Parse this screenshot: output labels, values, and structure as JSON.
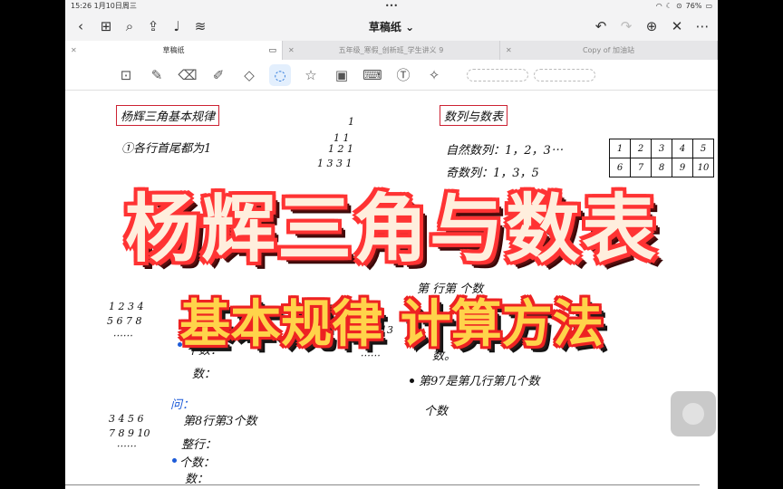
{
  "status": {
    "time": "15:26",
    "date": "1月10日周三",
    "dots": "•••",
    "battery": "76%"
  },
  "toolbar": {
    "title": "草稿纸",
    "title_caret": "⌄",
    "icons": [
      "back-icon",
      "grid-icon",
      "search-icon",
      "share-icon",
      "mic-icon",
      "audio-wave-icon",
      "undo-icon",
      "redo-icon",
      "add-page-icon",
      "close-icon",
      "more-icon"
    ]
  },
  "tabs": [
    {
      "label": "草稿纸",
      "active": true
    },
    {
      "label": "五年级_寒假_创新班_学生讲义 9",
      "active": false
    },
    {
      "label": "Copy of 加油站",
      "active": false
    }
  ],
  "tools": [
    "lasso-image-icon",
    "pen-icon",
    "eraser-icon",
    "highlighter-icon",
    "shapes-icon",
    "lasso-icon",
    "sticker-icon",
    "image-icon",
    "keyboard-icon",
    "text-icon",
    "laser-icon"
  ],
  "note": {
    "left_heading": "杨辉三角基本规律",
    "left_rule1": "①各行首尾都为1",
    "triangle": [
      "1",
      "1  1",
      "1  2  1",
      "1  3  3  1"
    ],
    "right_heading": "数列与数表",
    "nat_seq": "自然数列：1，2，3⋯",
    "odd_seq": "奇数列：1，3，5",
    "grid": [
      [
        "1",
        "2",
        "3",
        "4",
        "5"
      ],
      [
        "6",
        "7",
        "8",
        "9",
        "10"
      ]
    ],
    "left_mid1": "1 2 3 4",
    "left_mid2": "5 6 7 8",
    "left_mid3": "⋯⋯",
    "left_count_a": "个数：",
    "left_count_b": "数：",
    "mid_13": "13",
    "mid_dots": "⋯⋯",
    "right_q": "第  行第  个数",
    "right_shu": "数。",
    "right_97": "第97是第几行第几个数",
    "right_geshu": "个数",
    "wen": "问：",
    "bl_row1": "3 4 5 6",
    "bl_row2": "7 8 9 10",
    "bl_row3": "⋯⋯",
    "bl_q": "第8行第3个数",
    "bl_zheng": "整行：",
    "bl_geshu": "个数：",
    "bl_shu": "数："
  },
  "overlay": {
    "title": "杨辉三角与数表",
    "subtitle": "基本规律  计算方法"
  }
}
